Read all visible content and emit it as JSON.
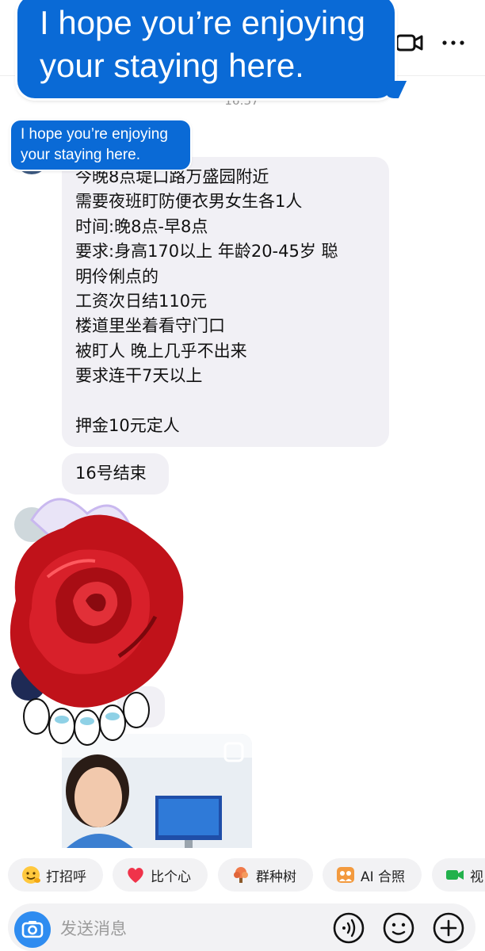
{
  "header": {
    "video_icon": "video-call-icon",
    "more_icon": "more-horizontal-icon"
  },
  "stickers": {
    "large_text": [
      "I hope you’re enjoying",
      "your staying here."
    ],
    "small_text": [
      "I hope you’re enjoying",
      "your staying here."
    ],
    "color": "#0a6ad6"
  },
  "chat": {
    "timestamp": "16:37",
    "message_lines": [
      "今晚8点堤口路万盛园附近",
      "需要夜班盯防便衣男女生各1人",
      "时间:晚8点-早8点",
      "要求:身高170以上 年龄20-45岁 聪",
      "明伶俐点的",
      "工资次日结110元",
      "楼道里坐着看守门口",
      "被盯人 晚上几乎不出来",
      "要求连干7天以上",
      "",
      "押金10元定人"
    ],
    "message_end": "16号结束",
    "bubble_color": "#f1f0f5"
  },
  "quick_replies": [
    {
      "label": "打招呼",
      "icon": "wave-emoji-icon"
    },
    {
      "label": "比个心",
      "icon": "heart-icon"
    },
    {
      "label": "群种树",
      "icon": "tree-icon"
    },
    {
      "label": "AI 合照",
      "icon": "ai-photo-icon"
    },
    {
      "label": "视",
      "icon": "video-icon"
    }
  ],
  "input": {
    "placeholder": "发送消息",
    "value": "",
    "camera_icon": "camera-icon",
    "voice_icon": "voice-icon",
    "emoji_icon": "emoji-icon",
    "plus_icon": "plus-icon",
    "accent_color": "#2f8cf0"
  }
}
